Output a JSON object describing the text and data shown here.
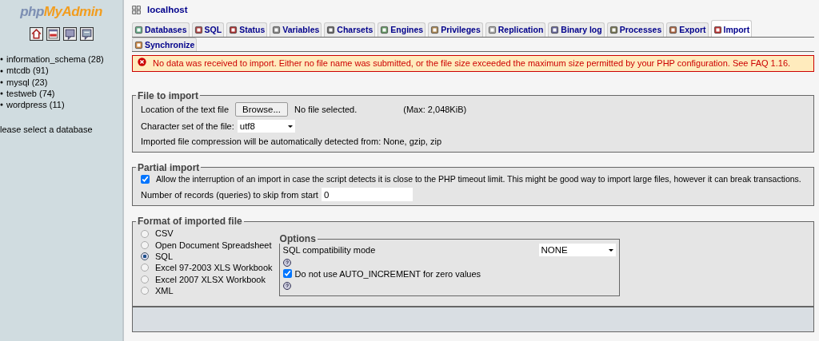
{
  "logo": {
    "part1": "php",
    "part2": "MyAdmin"
  },
  "databases": [
    "information_schema (28)",
    "mtcdb (91)",
    "mysql (23)",
    "testweb (74)",
    "wordpress (11)"
  ],
  "sidebar_hint": "lease select a database",
  "server": "localhost",
  "tabs": [
    {
      "label": "Databases",
      "selected": false
    },
    {
      "label": "SQL",
      "selected": false
    },
    {
      "label": "Status",
      "selected": false
    },
    {
      "label": "Variables",
      "selected": false
    },
    {
      "label": "Charsets",
      "selected": false
    },
    {
      "label": "Engines",
      "selected": false
    },
    {
      "label": "Privileges",
      "selected": false
    },
    {
      "label": "Replication",
      "selected": false
    },
    {
      "label": "Binary log",
      "selected": false
    },
    {
      "label": "Processes",
      "selected": false
    },
    {
      "label": "Export",
      "selected": false
    },
    {
      "label": "Import",
      "selected": true
    },
    {
      "label": "Synchronize",
      "selected": false
    }
  ],
  "error": {
    "text": "No data was received to import. Either no file name was submitted, or the file size exceeded the maximum size permitted by your PHP configuration. See",
    "link": "FAQ 1.16",
    "suffix": "."
  },
  "file_to_import": {
    "legend": "File to import",
    "location_label": "Location of the text file",
    "browse_button": "Browse...",
    "file_status": "No file selected.",
    "max": "(Max: 2,048KiB)",
    "charset_label": "Character set of the file:",
    "charset_value": "utf8",
    "compression_note": "Imported file compression will be automatically detected from: None, gzip, zip"
  },
  "partial_import": {
    "legend": "Partial import",
    "allow_interrupt": {
      "label": "Allow the interruption of an import in case the script detects it is close to the PHP timeout limit. This might be good way to import large files, however it can break transactions.",
      "checked": true
    },
    "skip_label": "Number of records (queries) to skip from start",
    "skip_value": "0"
  },
  "format": {
    "legend": "Format of imported file",
    "formats": [
      {
        "label": "CSV",
        "selected": false
      },
      {
        "label": "Open Document Spreadsheet",
        "selected": false
      },
      {
        "label": "SQL",
        "selected": true
      },
      {
        "label": "Excel 97-2003 XLS Workbook",
        "selected": false
      },
      {
        "label": "Excel 2007 XLSX Workbook",
        "selected": false
      },
      {
        "label": "XML",
        "selected": false
      }
    ],
    "options": {
      "legend": "Options",
      "compat_label": "SQL compatibility mode",
      "compat_value": "NONE",
      "no_auto_increment": {
        "label": "Do not use AUTO_INCREMENT for zero values",
        "checked": true
      }
    }
  }
}
